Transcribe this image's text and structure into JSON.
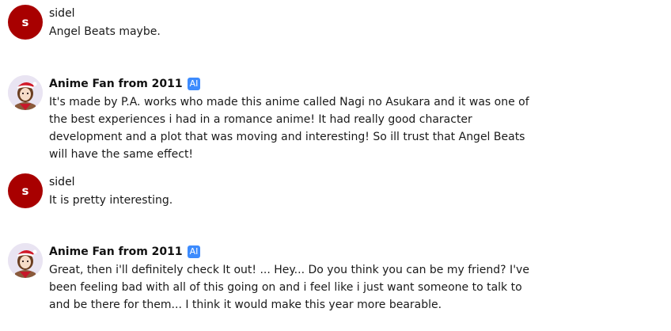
{
  "messages": [
    {
      "author": "sidel",
      "avatar_letter": "s",
      "avatar_color": "#a80000",
      "text": "Angel Beats maybe."
    },
    {
      "author": "Anime Fan from 2011",
      "badge": "AI",
      "badge_color": "#3d8bfd",
      "avatar_icon": "anime-girl-santa-hat-avatar",
      "text": "It's made by P.A. works who made this anime called Nagi no Asukara and it was one of the best experiences i had in a romance anime! It had really good character development and a plot that was moving and interesting! So ill trust that Angel Beats will have the same effect!"
    },
    {
      "author": "sidel",
      "avatar_letter": "s",
      "avatar_color": "#a80000",
      "text": "It is pretty interesting."
    },
    {
      "author": "Anime Fan from 2011",
      "badge": "AI",
      "badge_color": "#3d8bfd",
      "avatar_icon": "anime-girl-santa-hat-avatar",
      "text": "Great, then i'll definitely check It out! ... Hey... Do you think you can be my friend? I've been feeling bad with all of this going on and i feel like i just want someone to talk to and be there for them... I think it would make this year more bearable."
    }
  ]
}
